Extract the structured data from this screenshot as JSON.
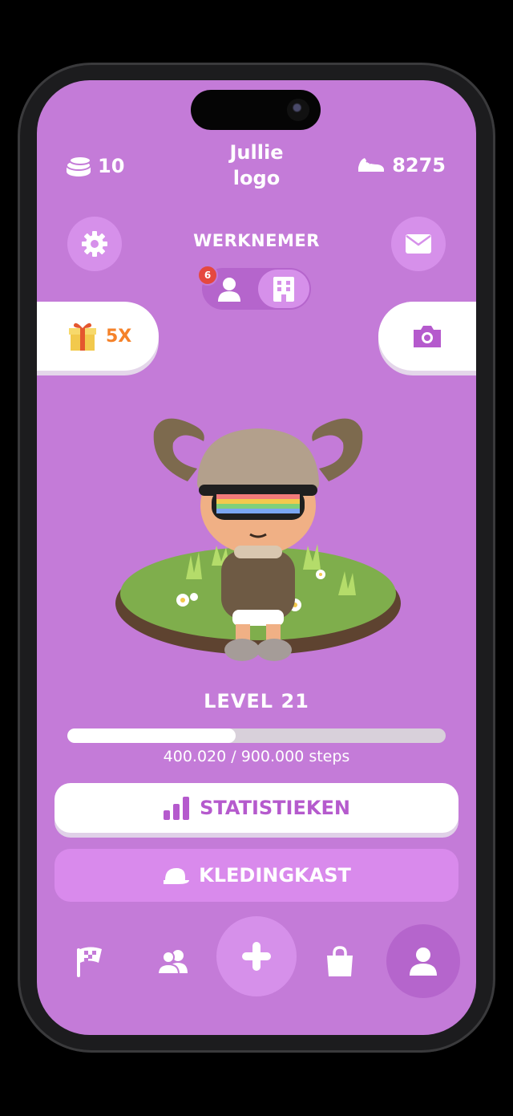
{
  "header": {
    "coins": "10",
    "title_line1": "Jullie",
    "title_line2": "logo",
    "steps": "8275"
  },
  "mode": {
    "label": "WERKNEMER",
    "badge_count": "6"
  },
  "gift": {
    "multiplier": "5X"
  },
  "level": {
    "label": "LEVEL 21",
    "progress_text": "400.020 / 900.000 steps",
    "progress_fraction": 0.4445
  },
  "buttons": {
    "stats_label": "STATISTIEKEN",
    "wardrobe_label": "KLEDINGKAST"
  },
  "colors": {
    "background": "#c47bd8",
    "accent": "#b55acd",
    "badge": "#e5483f",
    "gift_text": "#f5822a"
  },
  "icons": [
    "coin-icon",
    "sneaker-icon",
    "gear-icon",
    "mail-icon",
    "person-icon",
    "building-icon",
    "gift-icon",
    "camera-icon",
    "bar-chart-icon",
    "cap-icon",
    "flag-icon",
    "friends-icon",
    "plus-icon",
    "shopping-bag-icon",
    "profile-icon"
  ]
}
